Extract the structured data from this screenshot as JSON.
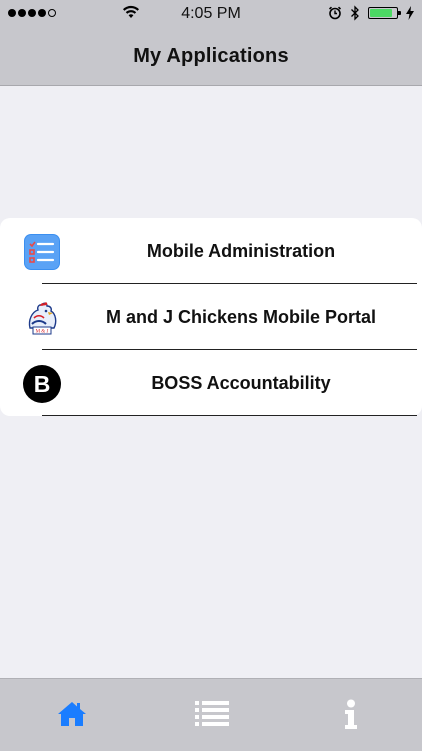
{
  "status_bar": {
    "time": "4:05 PM",
    "signal_dots_filled": 4,
    "signal_dots_total": 5,
    "battery_level": 0.8,
    "icons": [
      "signal-icon",
      "wifi-icon",
      "alarm-icon",
      "bluetooth-icon",
      "battery-icon",
      "charging-bolt-icon"
    ]
  },
  "navbar": {
    "title": "My Applications"
  },
  "apps": [
    {
      "label": "Mobile Administration",
      "icon": "checklist-icon"
    },
    {
      "label": "M and J Chickens Mobile Portal",
      "icon": "chicken-logo-icon",
      "logo_text": "M & J"
    },
    {
      "label": "BOSS Accountability",
      "icon": "boss-b-icon",
      "icon_letter": "B"
    }
  ],
  "tab_bar": {
    "tabs": [
      {
        "name": "home",
        "icon": "home-icon",
        "active": true
      },
      {
        "name": "list",
        "icon": "list-icon",
        "active": false
      },
      {
        "name": "info",
        "icon": "info-icon",
        "active": false
      }
    ],
    "active_color": "#1a7dff",
    "inactive_color": "#ffffff"
  }
}
